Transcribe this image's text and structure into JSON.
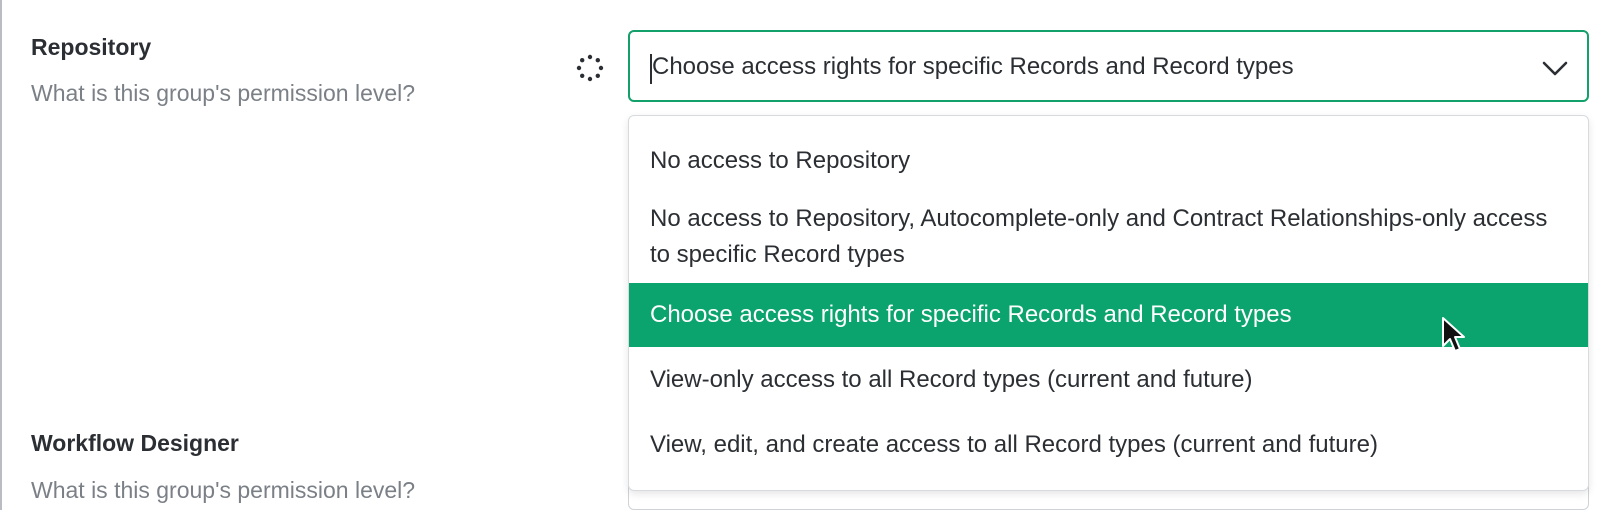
{
  "repository": {
    "label": "Repository",
    "help": "What is this group's permission level?",
    "select": {
      "value": "Choose access rights for specific Records and Record types",
      "options": [
        "No access to Repository",
        "No access to Repository, Autocomplete-only and Contract Relationships-only access to specific Record types",
        "Choose access rights for specific Records and Record types",
        "View-only access to all Record types (current and future)",
        "View, edit, and create access to all Record types (current and future)"
      ],
      "highlighted_option": "Choose access rights for specific Records and Record types"
    },
    "loading_icon": "spinner-icon"
  },
  "workflow_designer": {
    "label": "Workflow Designer",
    "help": "What is this group's permission level?"
  },
  "colors": {
    "accent": "#0ba46e",
    "focus_border": "#14a06a",
    "help_text": "#7b8087"
  }
}
